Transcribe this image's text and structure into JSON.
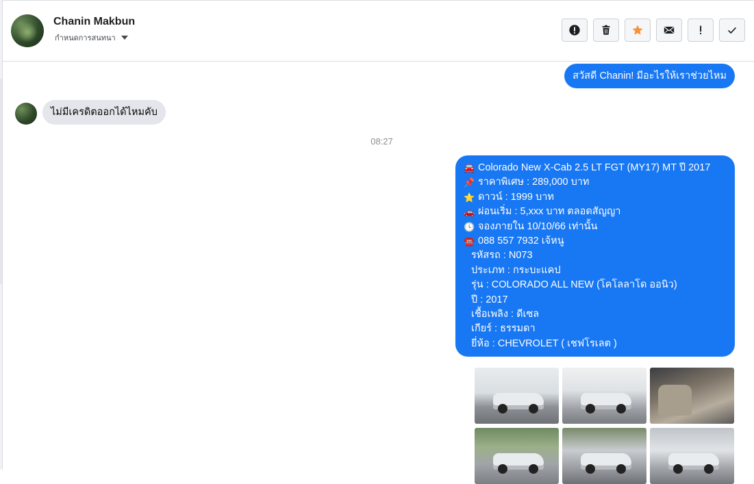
{
  "header": {
    "name": "Chanin Makbun",
    "subtitle": "กำหนดการสนทนา"
  },
  "actions": [
    {
      "icon": "alert-circle-icon"
    },
    {
      "icon": "trash-icon"
    },
    {
      "icon": "star-icon",
      "color": "#f7923a"
    },
    {
      "icon": "envelope-icon"
    },
    {
      "icon": "exclamation-icon"
    },
    {
      "icon": "check-icon"
    }
  ],
  "messages": {
    "greeting": "สวัสดี Chanin! มีอะไรให้เราช่วยไหม",
    "incoming": "ไม่มีเครดิตออกได้ไหมคับ",
    "timestamp": "08:27",
    "info_lines": [
      {
        "emoji": "🚘",
        "text": "Colorado New X-Cab 2.5 LT FGT (MY17) MT ปี 2017"
      },
      {
        "emoji": "📌",
        "text": "ราคาพิเศษ : 289,000 บาท"
      },
      {
        "emoji": "⭐",
        "text": "ดาวน์ : 1999 บาท"
      },
      {
        "emoji": "🚗",
        "text": "ผ่อนเริ่ม : 5,xxx บาท ตลอดสัญญา"
      },
      {
        "emoji": "🕓",
        "text": "จองภายใน 10/10/66 เท่านั้น"
      },
      {
        "emoji": "☎️",
        "text": "088 557 7932 เจ้หนู"
      },
      {
        "emoji": "",
        "text": "รหัสรถ : N073"
      },
      {
        "emoji": "",
        "text": "ประเภท : กระบะแคป"
      },
      {
        "emoji": "",
        "text": "รุ่น : COLORADO ALL NEW (โคโลลาโด ออนิว)"
      },
      {
        "emoji": "",
        "text": "ปี : 2017"
      },
      {
        "emoji": "",
        "text": "เชื้อเพลิง : ดีเซล"
      },
      {
        "emoji": "",
        "text": "เกียร์ : ธรรมดา"
      },
      {
        "emoji": "",
        "text": "ยี่ห้อ : CHEVROLET ( เชฟโรเลต )"
      }
    ]
  },
  "colors": {
    "accent": "#1877f2",
    "incoming_bg": "#e4e6eb",
    "star": "#f7923a"
  }
}
